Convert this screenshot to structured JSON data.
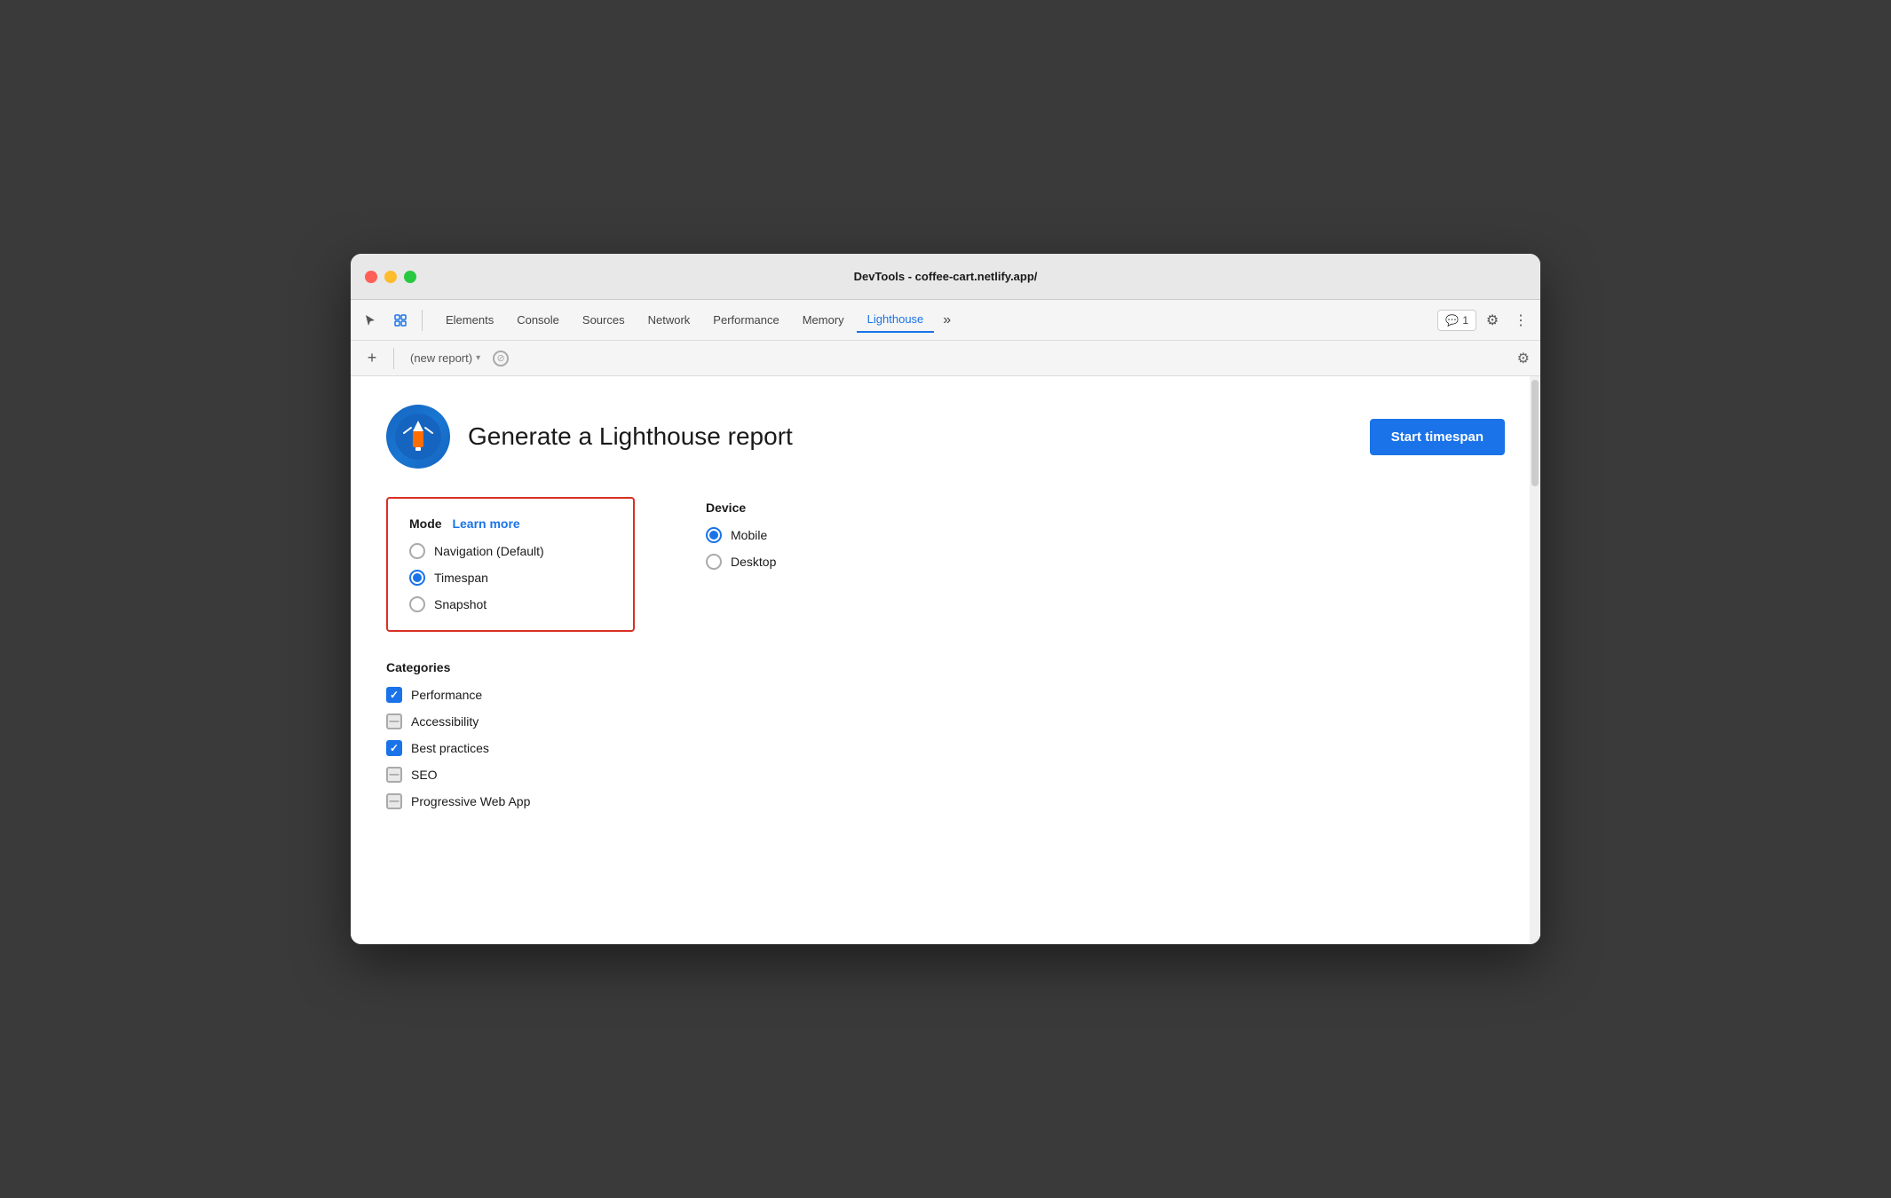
{
  "window": {
    "title": "DevTools - coffee-cart.netlify.app/"
  },
  "tabs": {
    "items": [
      {
        "label": "Elements",
        "active": false
      },
      {
        "label": "Console",
        "active": false
      },
      {
        "label": "Sources",
        "active": false
      },
      {
        "label": "Network",
        "active": false
      },
      {
        "label": "Performance",
        "active": false
      },
      {
        "label": "Memory",
        "active": false
      },
      {
        "label": "Lighthouse",
        "active": true
      }
    ],
    "more_label": "»",
    "badge_count": "1",
    "settings_label": "⚙",
    "more_dots": "⋮"
  },
  "subbar": {
    "plus": "+",
    "report_placeholder": "(new report)",
    "arrow": "▾",
    "block_icon": "⊘",
    "settings_icon": "⚙"
  },
  "header": {
    "title": "Generate a Lighthouse report",
    "start_button": "Start timespan"
  },
  "mode": {
    "title": "Mode",
    "learn_more": "Learn more",
    "options": [
      {
        "label": "Navigation (Default)",
        "selected": false
      },
      {
        "label": "Timespan",
        "selected": true
      },
      {
        "label": "Snapshot",
        "selected": false
      }
    ]
  },
  "device": {
    "title": "Device",
    "options": [
      {
        "label": "Mobile",
        "selected": true
      },
      {
        "label": "Desktop",
        "selected": false
      }
    ]
  },
  "categories": {
    "title": "Categories",
    "items": [
      {
        "label": "Performance",
        "state": "checked"
      },
      {
        "label": "Accessibility",
        "state": "indeterminate"
      },
      {
        "label": "Best practices",
        "state": "checked"
      },
      {
        "label": "SEO",
        "state": "indeterminate"
      },
      {
        "label": "Progressive Web App",
        "state": "indeterminate"
      }
    ]
  }
}
